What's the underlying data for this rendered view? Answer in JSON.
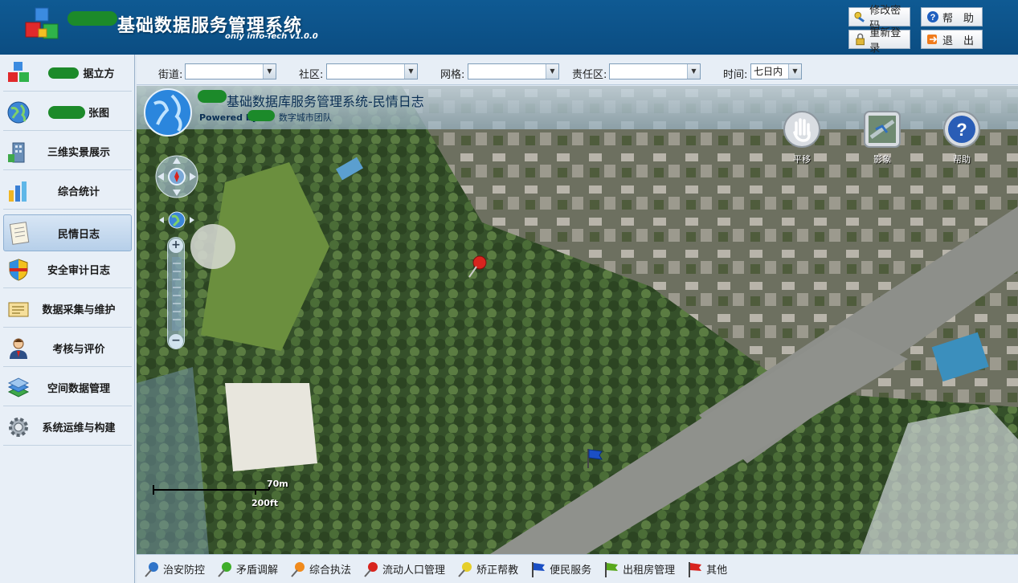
{
  "header": {
    "title": "基础数据服务管理系统",
    "subtitle": "only info-Tech v1.0.0",
    "buttons": {
      "change_password": "修改密码",
      "help": "帮　助",
      "relogin": "重新登录",
      "logout": "退　出"
    }
  },
  "sidebar": {
    "items": [
      {
        "label": "据立方",
        "icon": "cube-icon"
      },
      {
        "label": "张图",
        "icon": "globe-icon"
      },
      {
        "label": "三维实景展示",
        "icon": "building-icon"
      },
      {
        "label": "综合统计",
        "icon": "bar-chart-icon"
      },
      {
        "label": "民情日志",
        "icon": "notebook-icon",
        "active": true
      },
      {
        "label": "安全审计日志",
        "icon": "shield-icon"
      },
      {
        "label": "数据采集与维护",
        "icon": "card-icon"
      },
      {
        "label": "考核与评价",
        "icon": "person-icon"
      },
      {
        "label": "空间数据管理",
        "icon": "layers-icon"
      },
      {
        "label": "系统运维与构建",
        "icon": "gear-icon"
      }
    ]
  },
  "filters": {
    "street_label": "街道:",
    "street_value": "",
    "community_label": "社区:",
    "community_value": "",
    "grid_label": "网格:",
    "grid_value": "",
    "district_label": "责任区:",
    "district_value": "",
    "time_label": "时间:",
    "time_value": "七日内"
  },
  "map": {
    "title": "基础数据库服务管理系统-民情日志",
    "powered": "Powered by",
    "team": "数字城市团队",
    "tools": {
      "pan": "平移",
      "imagery": "影象",
      "help": "帮助"
    },
    "scale_metric": "70m",
    "scale_imperial": "200ft"
  },
  "legend": [
    {
      "label": "治安防控",
      "color": "#2f74c9"
    },
    {
      "label": "矛盾调解",
      "color": "#3fae2a"
    },
    {
      "label": "综合执法",
      "color": "#f08a1c"
    },
    {
      "label": "流动人口管理",
      "color": "#d8241e"
    },
    {
      "label": "矫正帮教",
      "color": "#e6cf2a"
    },
    {
      "label": "便民服务",
      "color": "#1b4fc4"
    },
    {
      "label": "出租房管理",
      "color": "#58a81c"
    },
    {
      "label": "其他",
      "color": "#d8241e"
    }
  ]
}
